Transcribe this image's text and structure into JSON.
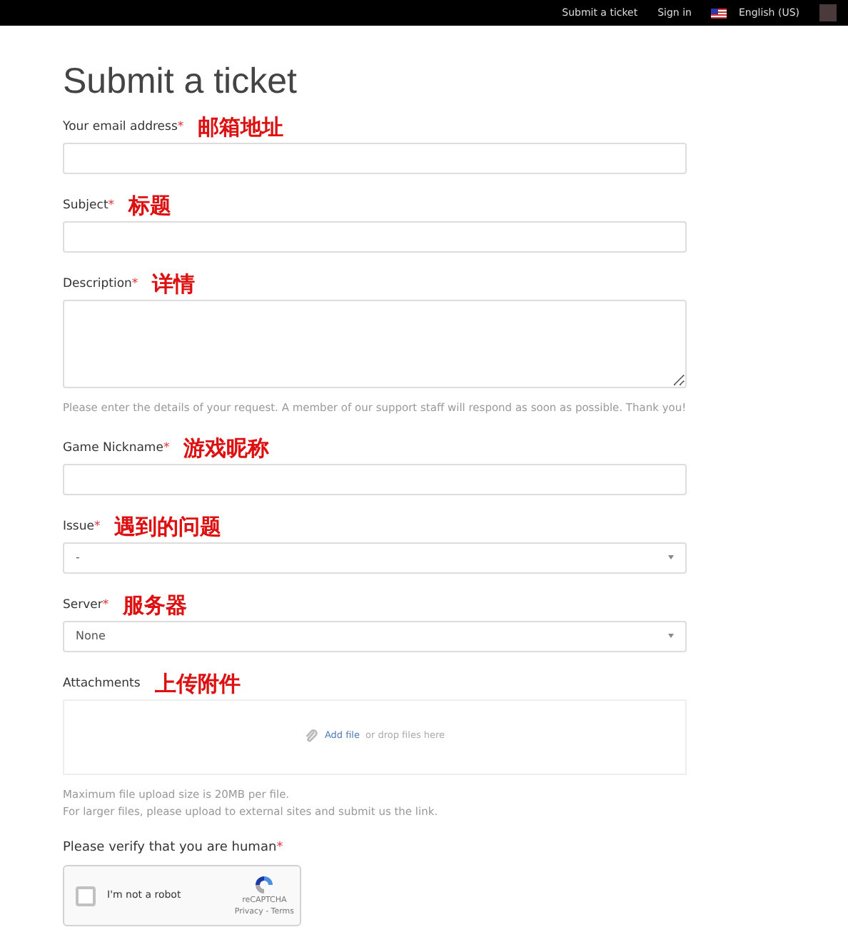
{
  "topbar": {
    "links": [
      "Submit a ticket",
      "Sign in"
    ],
    "language": "English (US)"
  },
  "title": "Submit a ticket",
  "fields": [
    {
      "kind": "text",
      "label": "Your email address",
      "required_mark": "*",
      "annotation": "邮箱地址"
    },
    {
      "kind": "text",
      "label": "Subject",
      "required_mark": "*",
      "annotation": "标题"
    },
    {
      "kind": "textarea",
      "label": "Description",
      "required_mark": "*",
      "annotation": "详情",
      "hints": [
        "Please enter the details of your request. A member of our support staff will respond as soon as possible. Thank you!"
      ]
    },
    {
      "kind": "text",
      "label": "Game Nickname",
      "required_mark": "*",
      "annotation": "游戏昵称"
    },
    {
      "kind": "select",
      "label": "Issue",
      "required_mark": "*",
      "annotation": "遇到的问题",
      "value": "-"
    },
    {
      "kind": "select",
      "label": "Server",
      "required_mark": "*",
      "annotation": "服务器",
      "value": "None"
    },
    {
      "kind": "upload",
      "label": "Attachments",
      "annotation": "上传附件",
      "link": "Add file",
      "text": "or drop files here",
      "hints": [
        "Maximum file upload size is 20MB per file.",
        "For larger files, please upload to external sites and submit us the link."
      ]
    }
  ],
  "captcha": {
    "label": "Please verify that you are human",
    "required_mark": "*",
    "checkbox_label": "I'm not a robot",
    "checked": false,
    "brand": "reCAPTCHA",
    "links": "Privacy - Terms"
  }
}
